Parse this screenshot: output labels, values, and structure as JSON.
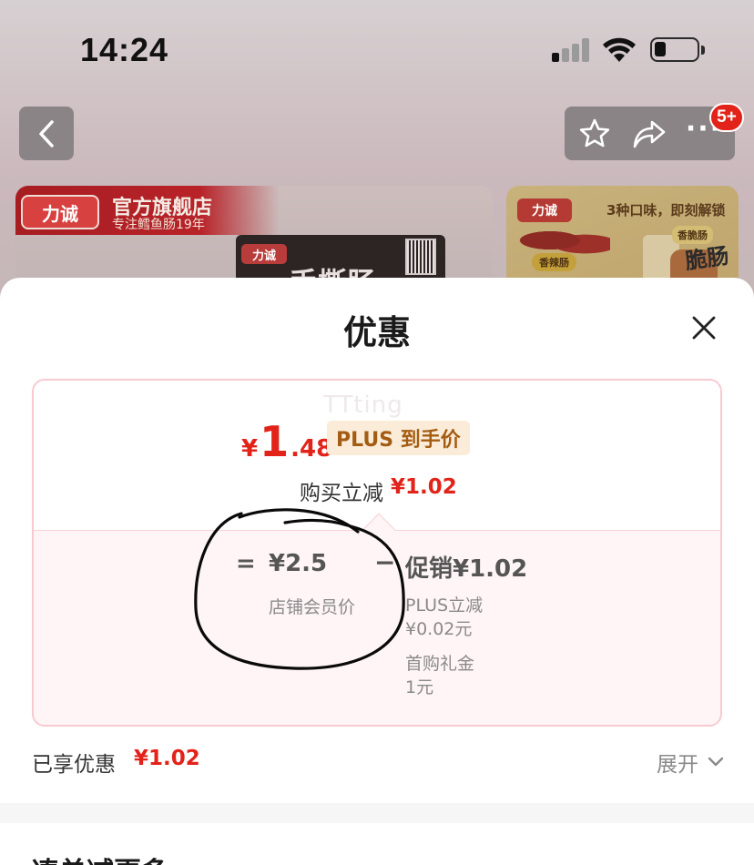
{
  "status_bar": {
    "time": "14:24",
    "signal_icon": "cellular-signal-icon",
    "wifi_icon": "wifi-icon",
    "battery_icon": "battery-icon",
    "battery_level": 0.28
  },
  "nav": {
    "back_icon": "chevron-left-icon",
    "star_icon": "star-outline-icon",
    "share_icon": "share-icon",
    "more_icon": "more-dots-icon",
    "more_dots": "···",
    "badge": "5+"
  },
  "banner": {
    "brand_logo": "力诚",
    "store_title": "官方旗舰店",
    "store_subtitle": "专注鳕鱼肠19年",
    "product_logo": "力诚",
    "product_name": "手撕肠",
    "side_logo": "力诚",
    "side_slogan": "3种口味，即刻解锁",
    "side_tag_spicy": "香辣肠",
    "side_tag_crispy": "香脆肠",
    "side_pack_label": "脆肠"
  },
  "sheet": {
    "title": "优惠",
    "close_icon": "close-icon",
    "watermark": "TTting",
    "final_price": {
      "symbol": "¥",
      "integer": "1",
      "decimal": ".48"
    },
    "plus_tag": "PLUS 到手价",
    "reduce_label": "购买立减",
    "reduce_amount": "¥1.02",
    "breakdown": {
      "equals": "=",
      "store_price": "¥2.5",
      "store_price_label": "店铺会员价",
      "minus": "−",
      "promo_title": "促销¥1.02",
      "promo_lines": [
        "PLUS立减",
        "¥0.02元",
        "首购礼金",
        "1元"
      ]
    },
    "enjoyed_label": "已享优惠",
    "enjoyed_amount": "¥1.02",
    "expand_label": "展开",
    "expand_icon": "chevron-down-icon",
    "next_section_title": "凑单减更多"
  },
  "colors": {
    "accent_red": "#e2231a",
    "plus_tag_bg": "#fbecd9",
    "plus_tag_text": "#a45c12",
    "card_border": "#f7c9d0",
    "card_bottom_bg": "#fff5f6"
  }
}
